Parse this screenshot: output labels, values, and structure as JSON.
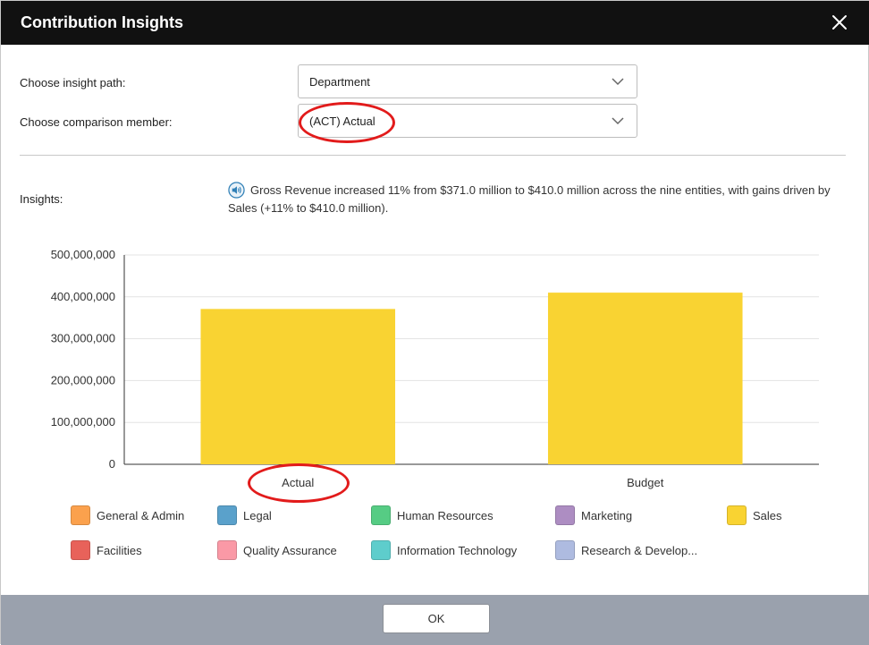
{
  "dialog": {
    "title": "Contribution Insights"
  },
  "form": {
    "insight_path_label": "Choose insight path:",
    "insight_path_value": "Department",
    "comparison_label": "Choose comparison member:",
    "comparison_value": "(ACT) Actual"
  },
  "insights": {
    "label": "Insights:",
    "text": "Gross Revenue increased 11% from $371.0 million to $410.0 million across the nine entities, with gains driven by Sales (+11% to $410.0 million).",
    "icon": "speaker-icon"
  },
  "chart_data": {
    "type": "bar",
    "categories": [
      "Actual",
      "Budget"
    ],
    "series": [
      {
        "name": "Sales",
        "values": [
          371000000,
          410000000
        ],
        "color": "#f9d332"
      }
    ],
    "ylim": [
      0,
      500000000
    ],
    "yticks": [
      0,
      100000000,
      200000000,
      300000000,
      400000000,
      500000000
    ],
    "ytick_labels": [
      "0",
      "100,000,000",
      "200,000,000",
      "300,000,000",
      "400,000,000",
      "500,000,000"
    ],
    "grid": true
  },
  "legend": [
    {
      "label": "General & Admin",
      "color": "#fba14d"
    },
    {
      "label": "Legal",
      "color": "#5aa1cb"
    },
    {
      "label": "Human Resources",
      "color": "#56cc84"
    },
    {
      "label": "Marketing",
      "color": "#ad8dc2"
    },
    {
      "label": "Sales",
      "color": "#f9d332"
    },
    {
      "label": "Facilities",
      "color": "#e8625a"
    },
    {
      "label": "Quality Assurance",
      "color": "#fa99a6"
    },
    {
      "label": "Information Technology",
      "color": "#5ecdcc"
    },
    {
      "label": "Research & Develop...",
      "color": "#aebbe0"
    }
  ],
  "footer": {
    "ok_label": "OK"
  },
  "colors": {
    "titlebar": "#111111",
    "footer": "#9aa1ad",
    "annotation": "#e21b1b"
  }
}
